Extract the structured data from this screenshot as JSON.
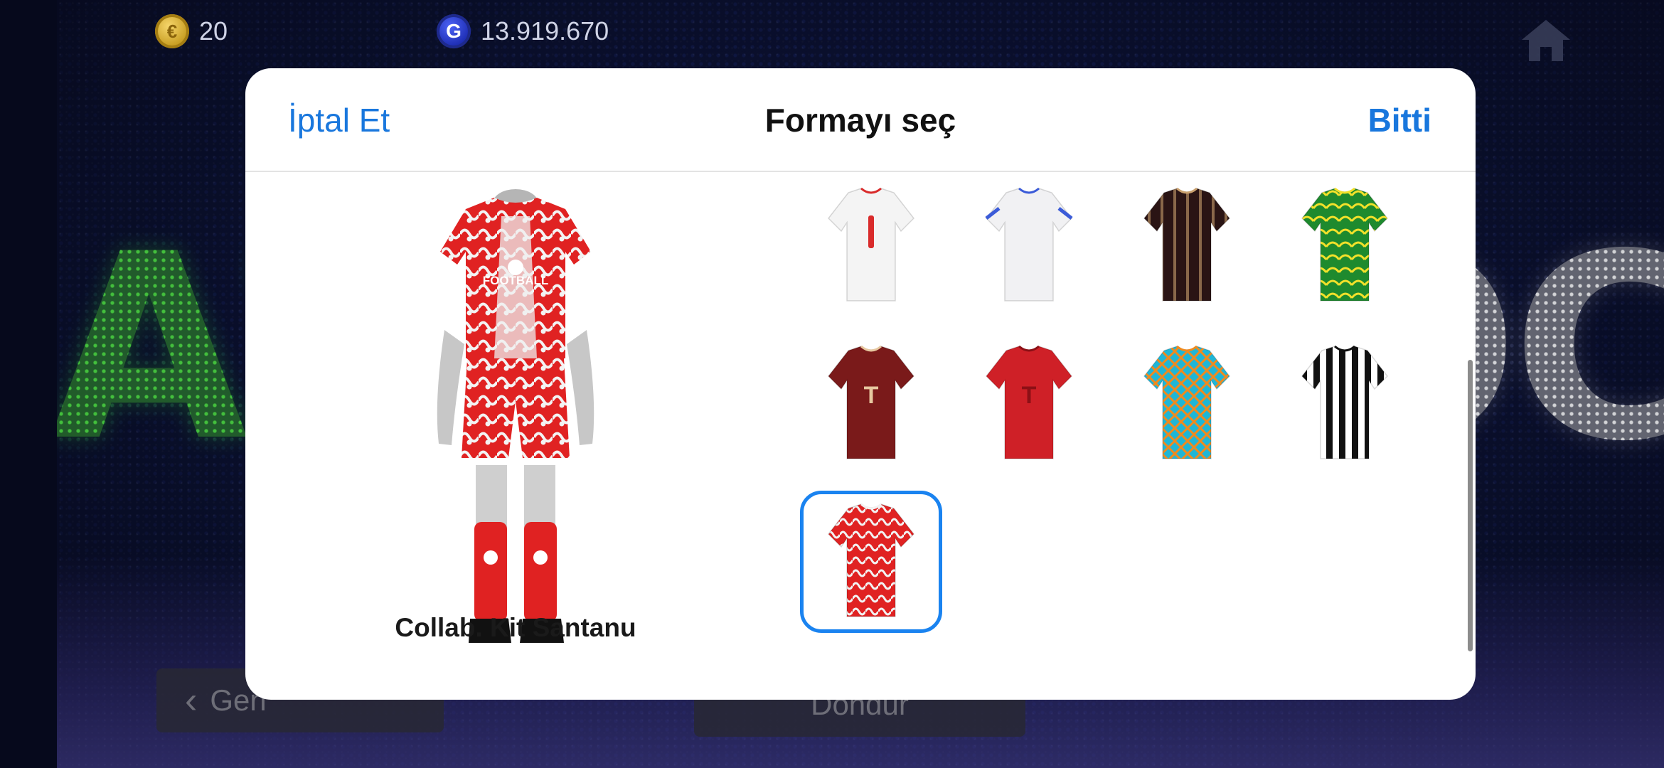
{
  "topbar": {
    "coins": {
      "value": "20",
      "icon": "coin-icon"
    },
    "gp": {
      "value": "13.919.670",
      "icon": "gp-icon",
      "icon_glyph": "G"
    },
    "home_icon": "home-icon"
  },
  "background": {
    "led_left": "AZ",
    "led_right": "OC",
    "back_button_label": "Geri",
    "center_button_label": "Dondur"
  },
  "modal": {
    "title": "Formayı seç",
    "cancel_label": "İptal Et",
    "done_label": "Bitti",
    "preview_kit_name": "Collab. Kit Santanu",
    "selected_index": 8,
    "kits": [
      {
        "name": "white-red-kit",
        "primary": "#f4f4f4",
        "accent": "#d92b2b"
      },
      {
        "name": "white-blue-kit",
        "primary": "#f1f1f3",
        "accent": "#3b5bd8"
      },
      {
        "name": "black-efootball-kit",
        "primary": "#2a1414",
        "accent": "#c9a06e"
      },
      {
        "name": "green-yellow-kit",
        "primary": "#1e8a2e",
        "accent": "#f2e12a"
      },
      {
        "name": "maroon-t-kit",
        "primary": "#7a1a1a",
        "accent": "#e7c8a0"
      },
      {
        "name": "red-t-kit",
        "primary": "#cf2027",
        "accent": "#8c1016"
      },
      {
        "name": "cyan-orange-kit",
        "primary": "#1fb6d6",
        "accent": "#f08a1e"
      },
      {
        "name": "black-white-striped-kit",
        "primary": "#ffffff",
        "accent": "#111111"
      },
      {
        "name": "collab-kit-santanu",
        "primary": "#e02222",
        "accent": "#f2f2f2"
      }
    ]
  }
}
